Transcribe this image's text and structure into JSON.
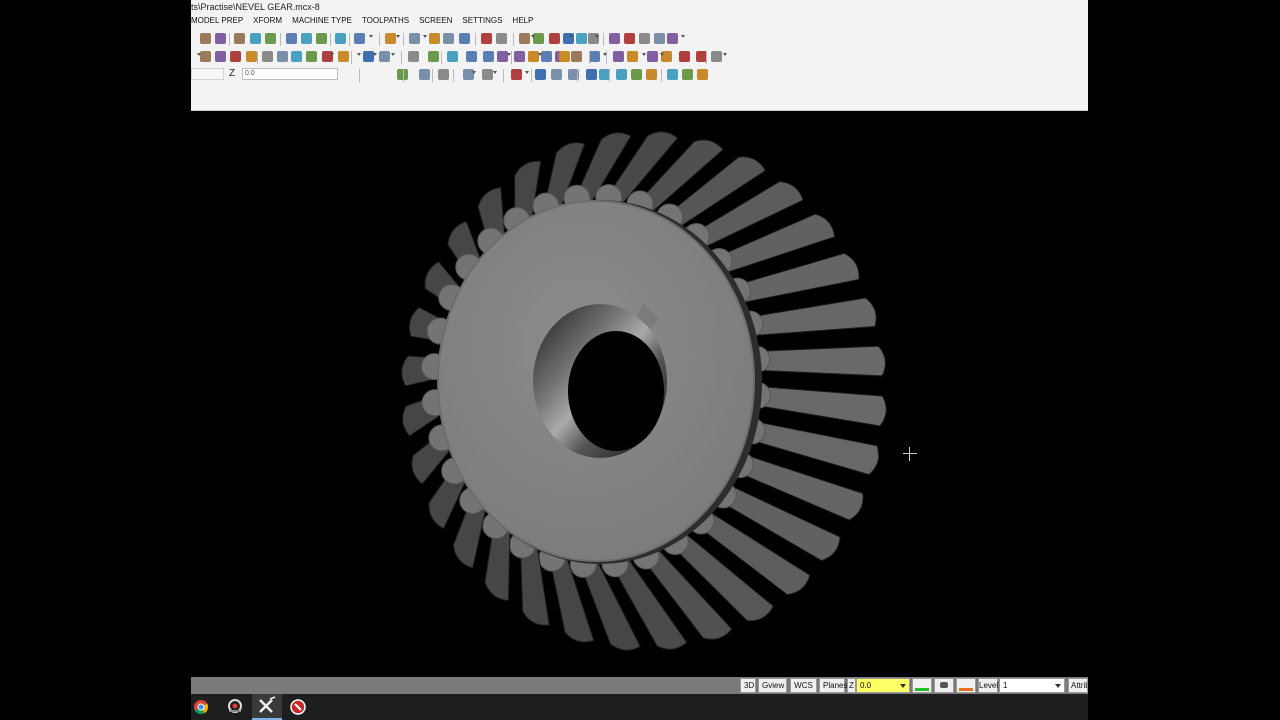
{
  "window": {
    "title": "ts\\Practise\\NEVEL GEAR.mcx-8"
  },
  "menu": [
    "MODEL PREP",
    "XFORM",
    "MACHINE TYPE",
    "TOOLPATHS",
    "SCREEN",
    "SETTINGS",
    "HELP"
  ],
  "toolbar": {
    "z_label": "Z",
    "z_value": "0.0"
  },
  "statusbar": {
    "btn_3d": "3D",
    "btn_gview": "Gview",
    "btn_wcs": "WCS",
    "btn_planes": "Planes",
    "z_label": "Z",
    "z_value": "0.0",
    "level_label": "Level",
    "level_value": "1",
    "attrib_label": "Attrib",
    "colors": {
      "z_field": "#ffff66",
      "accent_green": "#22c022",
      "accent_orange": "#e87020"
    }
  },
  "taskbar": {
    "apps": [
      "chrome-icon",
      "recorder-icon",
      "mastercam-icon",
      "capture-icon"
    ]
  },
  "viewport": {
    "background": "#000000",
    "model": "bevel-gear"
  }
}
